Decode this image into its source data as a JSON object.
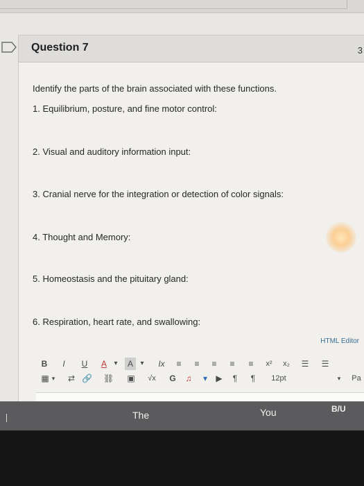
{
  "question": {
    "title": "Question 7",
    "points": "3",
    "prompt": "Identify the parts of the brain associated with these functions.",
    "items": [
      "1. Equilibrium, posture, and fine motor control:",
      "2. Visual and auditory information input:",
      "3. Cranial nerve for the integration or detection of color signals:",
      "4. Thought and Memory:",
      "5. Homeostasis and the pituitary gland:",
      "6. Respiration, heart rate, and swallowing:"
    ]
  },
  "editor": {
    "label": "HTML Editor",
    "toolbar1": [
      "B",
      "I",
      "U",
      "A",
      "▾",
      "A",
      "▾",
      "Ix",
      "≡",
      "≡",
      "≡",
      "≡",
      "≡",
      "x²",
      "x₂",
      "☰",
      "☰"
    ],
    "toolbar2": [
      "▦",
      "▾",
      "⇄",
      "🔗",
      "⛓",
      "▣",
      "√x",
      "G",
      "♫",
      "▾",
      "▶",
      "¶",
      "¶",
      "12pt",
      "▾",
      "Pa"
    ]
  },
  "taskbar": {
    "items": [
      "The",
      "You",
      "B/U"
    ]
  },
  "colors": {
    "accent": "#3b6e8f",
    "card": "#f1f0ed",
    "header": "#dedddb"
  }
}
